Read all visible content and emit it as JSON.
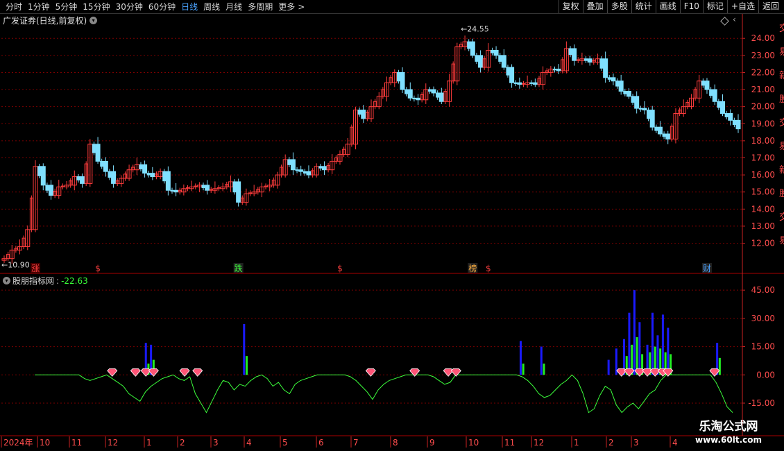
{
  "toolbar": {
    "periods": [
      "分时",
      "1分钟",
      "5分钟",
      "15分钟",
      "30分钟",
      "60分钟",
      "日线",
      "周线",
      "月线",
      "多周期",
      "更多"
    ],
    "active_period": "日线",
    "more_arrow": "chevron-right-icon",
    "tools": [
      "复权",
      "叠加",
      "多股",
      "统计",
      "画线",
      "F10",
      "标记",
      "+自选",
      "返回"
    ]
  },
  "main_chart": {
    "title": "广发证券(日线,前复权)",
    "high_label": "24.55",
    "low_label": "10.90",
    "event_markers": [
      {
        "date_index": 4,
        "text": "涨",
        "color": "#ff4040"
      },
      {
        "date_index": 12,
        "text": "$",
        "color": "#ff4040"
      },
      {
        "date_index": 30,
        "text": "跌",
        "color": "#3cff3c"
      },
      {
        "date_index": 43,
        "text": "$",
        "color": "#ff4040"
      },
      {
        "date_index": 60,
        "text": "榜",
        "color": "#ffb040"
      },
      {
        "date_index": 62,
        "text": "$",
        "color": "#ff4040"
      },
      {
        "date_index": 90,
        "text": "财",
        "color": "#4aa3ff"
      }
    ],
    "right_axis_side_text": "交易新股",
    "colors": {
      "up": "#ff3c3c",
      "down": "#7fe0ff",
      "grid": "#7a0000",
      "axis": "#ff3c3c"
    }
  },
  "chart_data": [
    {
      "type": "candlestick",
      "title": "广发证券(日线,前复权)",
      "y_ticks": [
        12.0,
        13.0,
        14.0,
        15.0,
        16.0,
        17.0,
        18.0,
        19.0,
        20.0,
        21.0,
        22.0,
        23.0,
        24.0
      ],
      "ylim": [
        10.6,
        24.7
      ],
      "close": [
        11.1,
        11.6,
        11.8,
        12.8,
        16.5,
        15.4,
        14.8,
        15.3,
        15.4,
        15.9,
        15.5,
        17.8,
        16.8,
        16.2,
        15.5,
        15.8,
        16.3,
        16.6,
        16.1,
        15.9,
        16.2,
        15.1,
        15.0,
        15.2,
        15.3,
        15.4,
        15.1,
        15.2,
        15.3,
        15.6,
        14.4,
        14.9,
        15.0,
        15.3,
        15.4,
        16.0,
        16.9,
        16.3,
        16.2,
        16.0,
        16.5,
        16.3,
        16.8,
        17.2,
        17.8,
        19.8,
        19.3,
        20.0,
        20.6,
        21.4,
        22.0,
        21.0,
        20.5,
        20.4,
        21.0,
        20.8,
        20.3,
        21.5,
        23.5,
        23.8,
        23.0,
        22.3,
        23.3,
        23.0,
        22.3,
        21.4,
        21.3,
        21.4,
        21.3,
        22.0,
        22.2,
        22.1,
        23.4,
        22.7,
        22.8,
        22.6,
        22.8,
        21.7,
        21.5,
        20.9,
        20.6,
        19.9,
        19.8,
        18.8,
        18.4,
        18.1,
        19.6,
        20.0,
        20.5,
        21.5,
        21.0,
        20.3,
        19.6,
        19.2,
        18.7
      ]
    },
    {
      "type": "indicator",
      "title": "股朋指标网",
      "current_value": "-22.63",
      "y_ticks": [
        45.0,
        30.0,
        15.0,
        0.0,
        -15.0
      ],
      "ylim": [
        -22,
        48
      ],
      "line": [
        0,
        0,
        0,
        0,
        0,
        0,
        0,
        0,
        0,
        -2,
        -3,
        -2,
        -1,
        0,
        -2,
        -4,
        -6,
        -10,
        -12,
        -14,
        -9,
        -6,
        -4,
        -2,
        -1,
        0,
        -2,
        -3,
        -1,
        -10,
        -15,
        -20,
        -14,
        -8,
        -3,
        -4,
        -8,
        -5,
        -6,
        -3,
        -1,
        0,
        -2,
        -6,
        -4,
        -8,
        -10,
        -5,
        -3,
        -2,
        -1,
        0,
        0,
        0,
        0,
        0,
        0,
        -1,
        -3,
        -6,
        -9,
        -13,
        -8,
        -5,
        -3,
        -2,
        -1,
        0,
        0,
        0,
        0,
        0,
        -1,
        -3,
        -5,
        -4,
        0,
        0,
        0,
        0,
        0,
        0,
        0,
        0,
        0,
        0,
        0,
        0,
        -1,
        -3,
        -6,
        -10,
        -12,
        -11,
        -8,
        -5,
        -3,
        0,
        -3,
        -10,
        -20,
        -18,
        -11,
        -6,
        -8,
        -16,
        -20,
        -17,
        -15,
        -18,
        -14,
        -10,
        -8,
        -3,
        0,
        0,
        0,
        0,
        0,
        0,
        0,
        0,
        0,
        -4,
        -10,
        -17,
        -20
      ],
      "blue_bars": [
        {
          "i": 43,
          "v": 17
        },
        {
          "i": 45,
          "v": 16
        },
        {
          "i": 81,
          "v": 27
        },
        {
          "i": 188,
          "v": 18
        },
        {
          "i": 196,
          "v": 15
        },
        {
          "i": 222,
          "v": 8
        },
        {
          "i": 225,
          "v": 14
        },
        {
          "i": 228,
          "v": 19
        },
        {
          "i": 230,
          "v": 33
        },
        {
          "i": 232,
          "v": 45
        },
        {
          "i": 234,
          "v": 28
        },
        {
          "i": 237,
          "v": 16
        },
        {
          "i": 239,
          "v": 33
        },
        {
          "i": 241,
          "v": 21
        },
        {
          "i": 243,
          "v": 32
        },
        {
          "i": 245,
          "v": 25
        },
        {
          "i": 264,
          "v": 17
        }
      ],
      "green_bars": [
        {
          "i": 44,
          "v": 6
        },
        {
          "i": 46,
          "v": 8
        },
        {
          "i": 82,
          "v": 10
        },
        {
          "i": 189,
          "v": 6
        },
        {
          "i": 197,
          "v": 6
        },
        {
          "i": 229,
          "v": 10
        },
        {
          "i": 231,
          "v": 16
        },
        {
          "i": 233,
          "v": 20
        },
        {
          "i": 235,
          "v": 11
        },
        {
          "i": 238,
          "v": 12
        },
        {
          "i": 240,
          "v": 15
        },
        {
          "i": 242,
          "v": 14
        },
        {
          "i": 244,
          "v": 12
        },
        {
          "i": 246,
          "v": 11
        },
        {
          "i": 265,
          "v": 9
        }
      ],
      "diamond_positions": [
        30,
        39,
        43,
        46,
        58,
        63,
        130,
        147,
        160,
        163,
        227,
        230,
        234,
        237,
        240,
        243,
        245,
        263
      ]
    }
  ],
  "time_axis": {
    "labels": [
      "2024年",
      "10",
      "11",
      "12",
      "1",
      "2",
      "3",
      "4",
      "5",
      "6",
      "7",
      "8",
      "9",
      "10",
      "11",
      "12",
      "1",
      "2",
      "3",
      "4"
    ]
  },
  "watermark": {
    "line1": "乐淘公式网",
    "line2": "www.60lt.com"
  }
}
